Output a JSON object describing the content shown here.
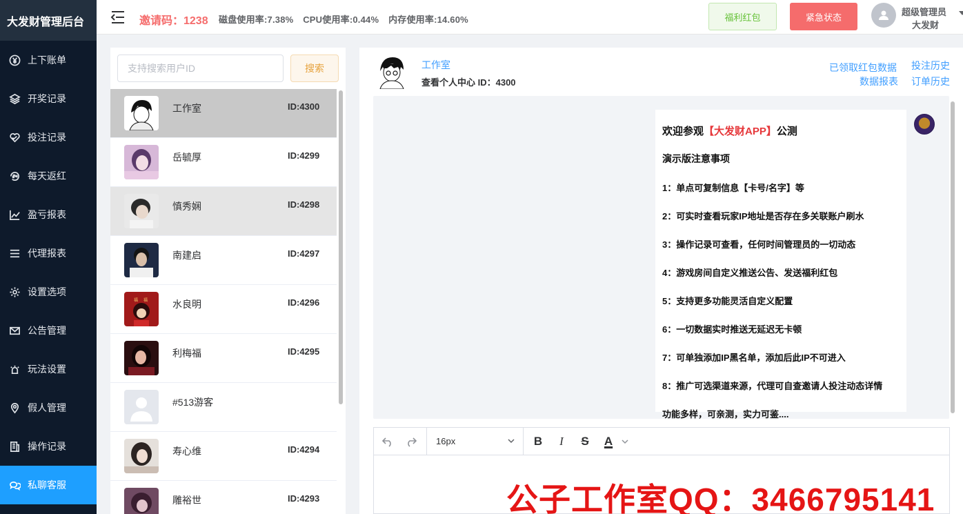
{
  "brand": "大发财管理后台",
  "menu": [
    {
      "label": "上下账单",
      "icon": "yen-circle-icon"
    },
    {
      "label": "开奖记录",
      "icon": "layers-icon"
    },
    {
      "label": "投注记录",
      "icon": "heart-icon"
    },
    {
      "label": "每天返红",
      "icon": "24h-icon"
    },
    {
      "label": "盈亏报表",
      "icon": "line-chart-icon"
    },
    {
      "label": "代理报表",
      "icon": "list-icon"
    },
    {
      "label": "设置选项",
      "icon": "gear-icon"
    },
    {
      "label": "公告管理",
      "icon": "mail-icon"
    },
    {
      "label": "玩法设置",
      "icon": "alarm-icon"
    },
    {
      "label": "假人管理",
      "icon": "location-icon"
    },
    {
      "label": "操作记录",
      "icon": "document-icon"
    },
    {
      "label": "私聊客服",
      "icon": "chat-icon"
    }
  ],
  "header": {
    "invite": "邀请码：1238",
    "disk": "磁盘使用率:7.38%",
    "cpu": "CPU使用率:0.44%",
    "mem": "内存使用率:14.60%",
    "welfare_btn": "福利红包",
    "emergency_btn": "紧急状态",
    "user_role": "超级管理员",
    "user_name": "大发财"
  },
  "search": {
    "placeholder": "支持搜索用户ID",
    "button": "搜索"
  },
  "users": [
    {
      "name": "工作室",
      "id": "ID:4300"
    },
    {
      "name": "岳毓厚",
      "id": "ID:4299"
    },
    {
      "name": "慎秀娴",
      "id": "ID:4298"
    },
    {
      "name": "南建启",
      "id": "ID:4297"
    },
    {
      "name": "水良明",
      "id": "ID:4296"
    },
    {
      "name": "利梅福",
      "id": "ID:4295"
    },
    {
      "name": "#513游客",
      "id": ""
    },
    {
      "name": "寿心维",
      "id": "ID:4294"
    },
    {
      "name": "雕裕世",
      "id": "ID:4293"
    }
  ],
  "chat": {
    "name": "工作室",
    "sub": "查看个人中心 ID：4300",
    "links": {
      "redpacket": "已领取红包数据",
      "bet_history": "投注历史",
      "report": "数据报表",
      "order_history": "订单历史"
    },
    "message": {
      "title_pre": "欢迎参观",
      "title_hl": "【大发财APP】",
      "title_post": "公测",
      "heading": "演示版注意事项",
      "lines": [
        "1：单点可复制信息【卡号/名字】等",
        "2：可实时查看玩家IP地址是否存在多关联账户刷水",
        "3：操作记录可查看，任何时间管理员的一切动态",
        "4：游戏房间自定义推送公告、发送福利红包",
        "5：支持更多功能灵活自定义配置",
        "6：一切数据实时推送无延迟无卡顿",
        "7：可单独添加IP黑名单，添加后此IP不可进入",
        "8：推广可选渠道来源，代理可自查邀请人投注动态详情",
        "功能多样，可亲测，实力可鉴...."
      ]
    }
  },
  "editor": {
    "font_size": "16px",
    "bold": "B",
    "italic": "I",
    "strike": "S",
    "color": "A",
    "watermark": "公子工作室QQ：3466795141"
  }
}
